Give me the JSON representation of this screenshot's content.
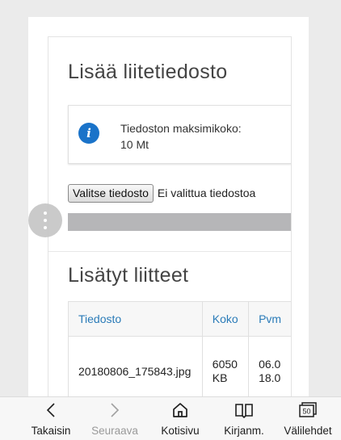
{
  "upload": {
    "title": "Lisää liitetiedosto",
    "info": {
      "icon": "info-icon",
      "line1": "Tiedoston maksimikoko:",
      "line2": "10 Mt"
    },
    "choose_button_label": "Valitse tiedosto",
    "file_status": "Ei valittua tiedostoa",
    "progress_fraction": 0
  },
  "attachments": {
    "title": "Lisätyt liitteet",
    "columns": [
      "Tiedosto",
      "Koko",
      "Pvm"
    ],
    "rows": [
      {
        "file": "20180806_175843.jpg",
        "size_line1": "6050",
        "size_line2": "KB",
        "date_line1": "06.0",
        "date_line2": "18.0"
      }
    ]
  },
  "floating_menu_icon": "kebab-menu-icon",
  "bottom_nav": {
    "items": [
      {
        "label": "Takaisin",
        "icon": "chevron-left-icon",
        "enabled": true
      },
      {
        "label": "Seuraava",
        "icon": "chevron-right-icon",
        "enabled": false
      },
      {
        "label": "Kotisivu",
        "icon": "home-icon",
        "enabled": true
      },
      {
        "label": "Kirjanm.",
        "icon": "bookmarks-icon",
        "enabled": true
      },
      {
        "label": "Välilehdet",
        "icon": "tabs-icon",
        "badge": "50",
        "enabled": true
      }
    ]
  },
  "colors": {
    "accent_link": "#2a7bb8",
    "info_icon": "#1a73c9",
    "progress_bar": "#b6b6b8"
  }
}
